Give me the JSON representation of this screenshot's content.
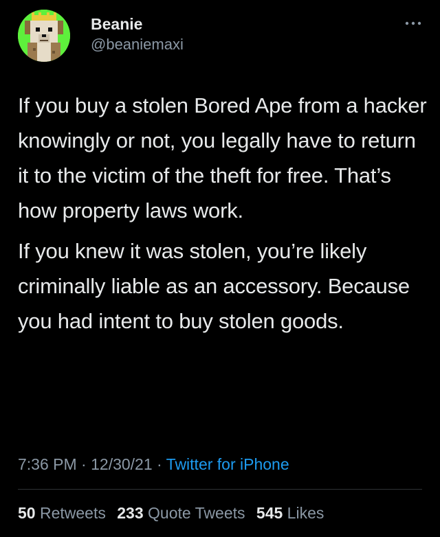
{
  "author": {
    "display_name": "Beanie",
    "handle": "@beaniemaxi",
    "avatar_icon": "pixel-dog-avatar-icon",
    "avatar_bg": "#5ef03c"
  },
  "more_icon": "more-options-icon",
  "tweet": {
    "paragraphs": [
      "If you buy a stolen Bored Ape from a hacker knowingly or not, you legally have to return it to the victim of the theft for free. That’s how property laws work.",
      "If you knew it was stolen, you’re likely criminally liable as an accessory. Because you had intent to buy stolen goods."
    ]
  },
  "meta": {
    "time": "7:36 PM",
    "sep": " · ",
    "date": "12/30/21",
    "source": "Twitter for iPhone"
  },
  "stats": {
    "retweets_count": "50",
    "retweets_label": "Retweets",
    "quotes_count": "233",
    "quotes_label": "Quote Tweets",
    "likes_count": "545",
    "likes_label": "Likes"
  },
  "colors": {
    "background": "#000000",
    "text": "#e7e9ea",
    "secondary": "#8b98a5",
    "link": "#1d9bf0",
    "divider": "#2f3336"
  }
}
